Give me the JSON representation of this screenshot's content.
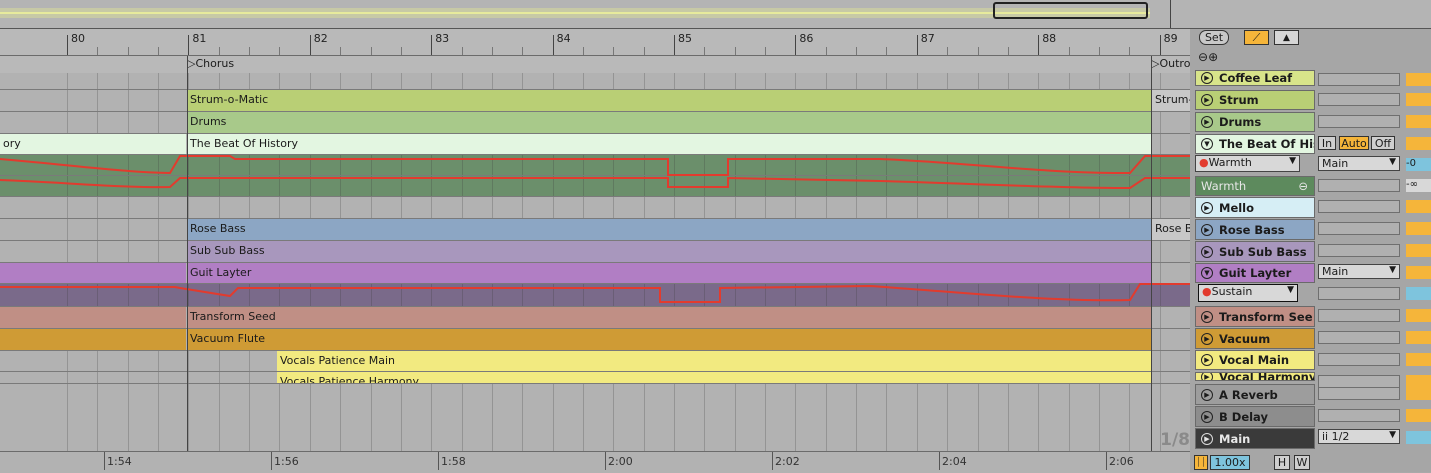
{
  "bar_numbers": [
    "80",
    "81",
    "82",
    "83",
    "84",
    "85",
    "86",
    "87",
    "88",
    "89"
  ],
  "locators": [
    {
      "label": "Chorus"
    },
    {
      "label": "Outro"
    }
  ],
  "time_labels": [
    "1:54",
    "1:56",
    "1:58",
    "2:00",
    "2:02",
    "2:04",
    "2:06"
  ],
  "controls": {
    "set_label": "Set",
    "zoom_label": "1.00x",
    "h_label": "H",
    "w_label": "W",
    "grid_label": "1/8"
  },
  "tracks": [
    {
      "name": "Coffee Leaf",
      "color": "#d8e48a"
    },
    {
      "name": "Strum",
      "clip": "Strum-o-Matic",
      "clip_tail": "Strum-",
      "color": "#b9cf75"
    },
    {
      "name": "Drums",
      "clip": "Drums",
      "color": "#a8c98a"
    },
    {
      "name": "The Beat Of His",
      "clip": "The Beat Of History",
      "clip_left": "ory",
      "color": "#e3f6e1",
      "mode": [
        "In",
        "Auto",
        "Off"
      ]
    },
    {
      "name": "Warmth",
      "color": "#5d8a5d",
      "param": "Warmth",
      "route": "Main",
      "meter": "-0"
    },
    {
      "name": "Warmth",
      "color": "#5d8a5d",
      "meter": "-∞"
    },
    {
      "name": "Mello",
      "color": "#d6eef5"
    },
    {
      "name": "Rose Bass",
      "clip": "Rose Bass",
      "clip_tail": "Rose B",
      "color": "#8ca6c4"
    },
    {
      "name": "Sub Sub Bass",
      "clip": "Sub Sub Bass",
      "color": "#a897bd"
    },
    {
      "name": "Guit Layter",
      "clip": "Guit Layter",
      "color": "#b17ec4",
      "route": "Main"
    },
    {
      "name": "Sustain",
      "param": "Sustain"
    },
    {
      "name": "Transform See",
      "clip": "Transform Seed",
      "color": "#c08f85"
    },
    {
      "name": "Vacuum",
      "clip": "Vacuum Flute",
      "color": "#cf9b35"
    },
    {
      "name": "Vocal Main",
      "clip": "Vocals Patience Main",
      "color": "#f2ea80"
    },
    {
      "name": "Vocal Harmony",
      "clip": "Vocals Patience Harmony",
      "color": "#f2ea80"
    },
    {
      "name": "A Reverb",
      "color": "#9d9d9d"
    },
    {
      "name": "B Delay",
      "color": "#8d8d8d"
    },
    {
      "name": "Main",
      "color": "#3a3a3a",
      "route": "ii 1/2"
    }
  ]
}
